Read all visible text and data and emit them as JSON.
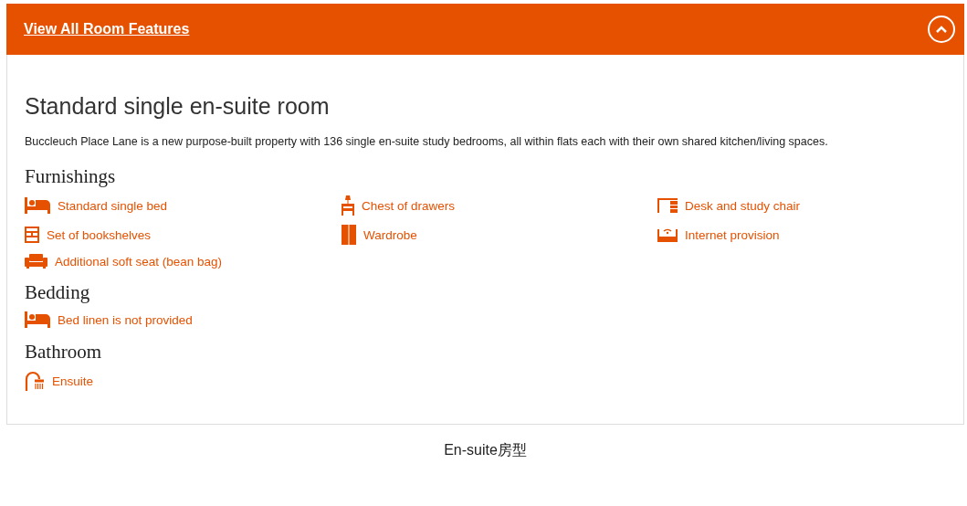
{
  "header": {
    "link": "View All Room Features",
    "expanded": true
  },
  "room": {
    "title": "Standard single en-suite room",
    "description": "Buccleuch Place Lane is a new purpose-built property with 136 single en-suite study bedrooms, all within flats each with their own shared kitchen/living spaces."
  },
  "sections": [
    {
      "heading": "Furnishings",
      "items": [
        {
          "label": "Standard single bed",
          "kind": "bed"
        },
        {
          "label": "Chest of drawers",
          "kind": "chest"
        },
        {
          "label": "Desk and study chair",
          "kind": "desk"
        },
        {
          "label": "Set of bookshelves",
          "kind": "shelves"
        },
        {
          "label": "Wardrobe",
          "kind": "wardrobe"
        },
        {
          "label": "Internet provision",
          "kind": "router"
        },
        {
          "label": "Additional soft seat (bean bag)",
          "kind": "sofa"
        }
      ]
    },
    {
      "heading": "Bedding",
      "items": [
        {
          "label": "Bed linen is not provided",
          "kind": "bed"
        }
      ]
    },
    {
      "heading": "Bathroom",
      "items": [
        {
          "label": "Ensuite",
          "kind": "shower"
        }
      ]
    }
  ],
  "caption": "En-suite房型"
}
